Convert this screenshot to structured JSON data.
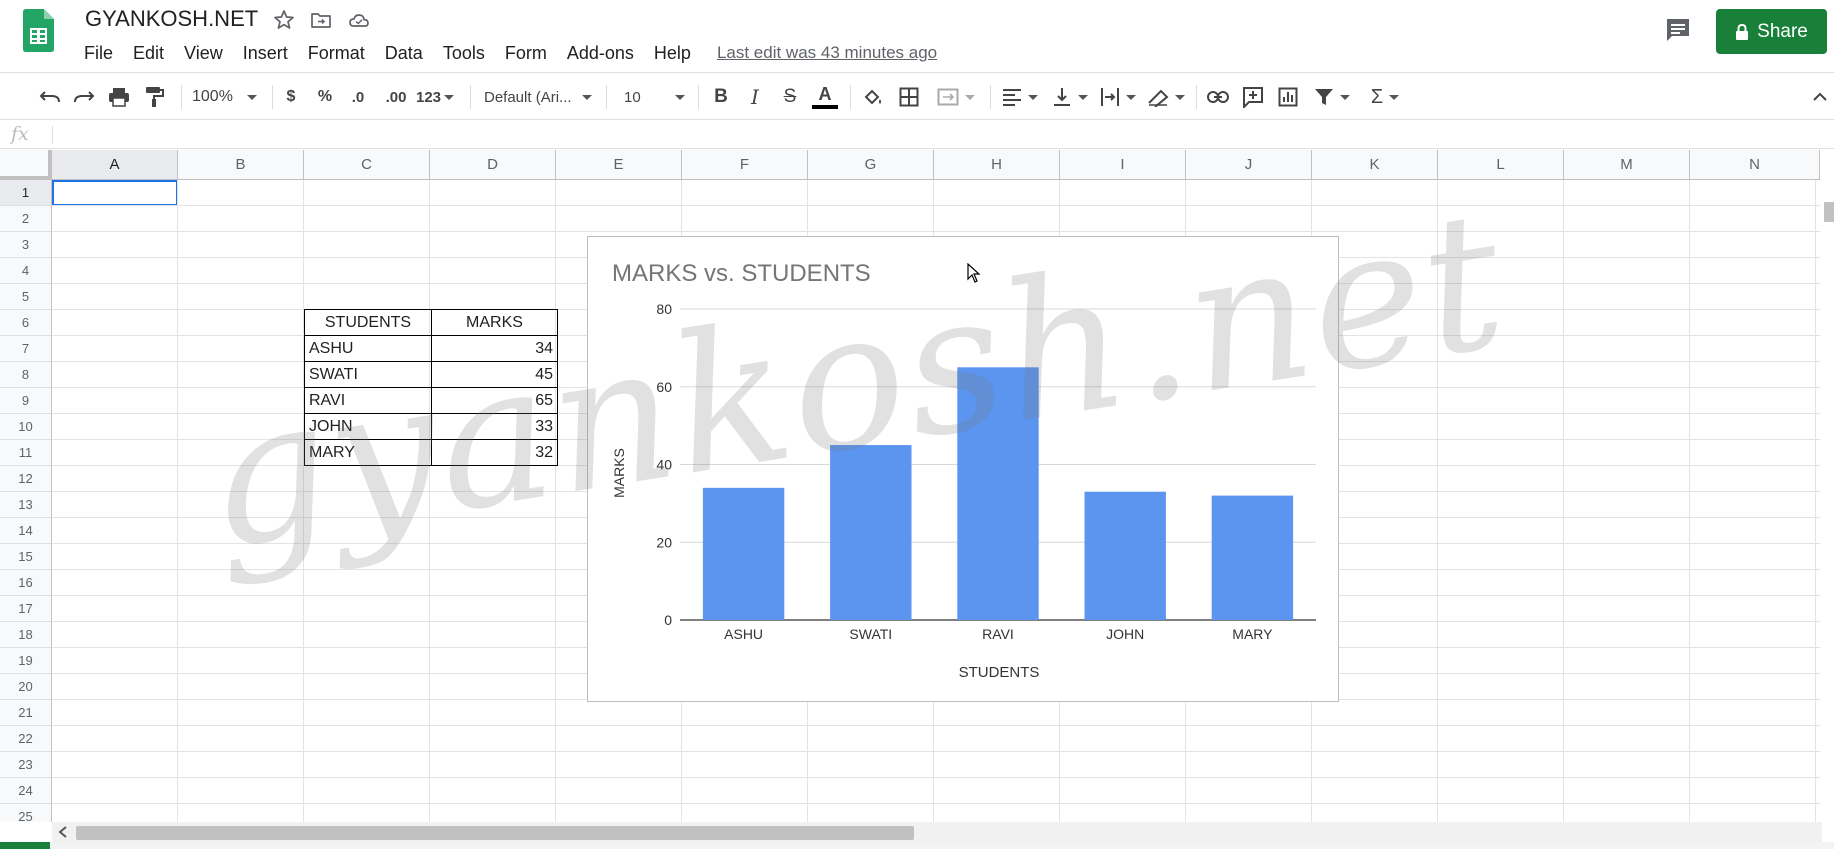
{
  "app": {
    "doc_title": "GYANKOSH.NET",
    "share_label": "Share",
    "last_edit": "Last edit was 43 minutes ago"
  },
  "menu": [
    "File",
    "Edit",
    "View",
    "Insert",
    "Format",
    "Data",
    "Tools",
    "Form",
    "Add-ons",
    "Help"
  ],
  "toolbar": {
    "zoom": "100%",
    "currency": "$",
    "percent": "%",
    "decimal_decrease": ".0",
    "decimal_increase": ".00",
    "more_formats": "123",
    "font": "Default (Ari...",
    "font_size": "10",
    "bold": "B",
    "italic": "I",
    "strike": "S",
    "text_color": "A"
  },
  "formula_bar": {
    "fx_label": "fx",
    "value": ""
  },
  "grid": {
    "columns": [
      "A",
      "B",
      "C",
      "D",
      "E",
      "F",
      "G",
      "H",
      "I",
      "J",
      "K",
      "L",
      "M",
      "N"
    ],
    "rows": [
      "1",
      "2",
      "3",
      "4",
      "5",
      "6",
      "7",
      "8",
      "9",
      "10",
      "11",
      "12",
      "13",
      "14",
      "15",
      "16",
      "17",
      "18",
      "19",
      "20",
      "21",
      "22",
      "23",
      "24",
      "25"
    ],
    "selected_cell": "A1"
  },
  "table": {
    "headers": [
      "STUDENTS",
      "MARKS"
    ],
    "rows": [
      [
        "ASHU",
        "34"
      ],
      [
        "SWATI",
        "45"
      ],
      [
        "RAVI",
        "65"
      ],
      [
        "JOHN",
        "33"
      ],
      [
        "MARY",
        "32"
      ]
    ]
  },
  "chart_data": {
    "type": "bar",
    "title": "MARKS vs. STUDENTS",
    "xlabel": "STUDENTS",
    "ylabel": "MARKS",
    "categories": [
      "ASHU",
      "SWATI",
      "RAVI",
      "JOHN",
      "MARY"
    ],
    "values": [
      34,
      45,
      65,
      33,
      32
    ],
    "ylim": [
      0,
      80
    ],
    "yticks": [
      "0",
      "20",
      "40",
      "60",
      "80"
    ],
    "grid": true,
    "legend": "none",
    "color": "#5b95f0"
  },
  "watermark": "gyankosh.net",
  "colors": {
    "brand_green": "#188038",
    "selection_blue": "#1a73e8",
    "bar_blue": "#5b95f0"
  }
}
